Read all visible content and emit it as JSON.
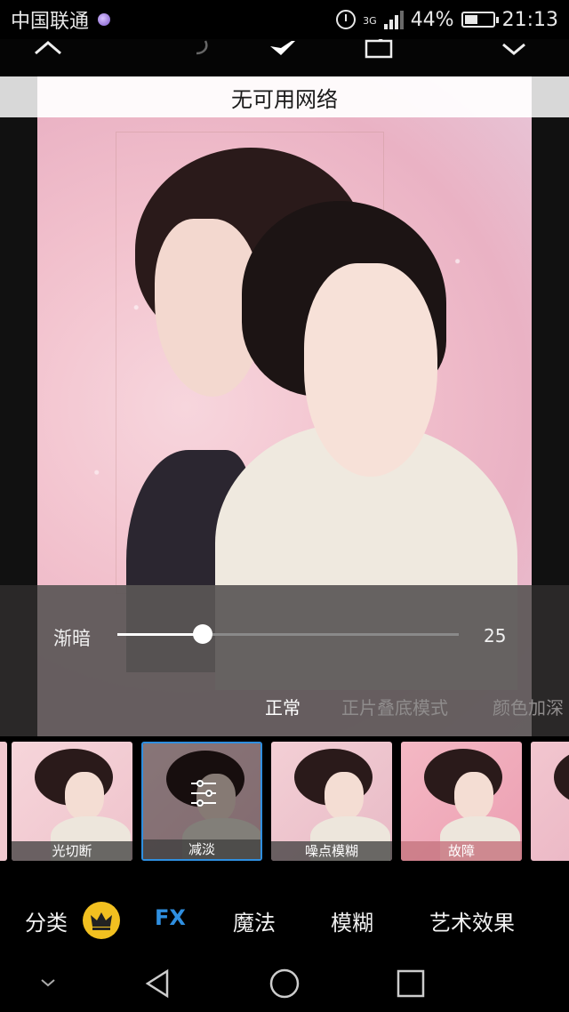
{
  "status_bar": {
    "carrier": "中国联通",
    "network": "3G",
    "battery": "44%",
    "time": "21:13"
  },
  "toolbar": {
    "icons": [
      "collapse-up-icon",
      "undo-icon",
      "eraser-icon",
      "export-icon",
      "apply-check-icon"
    ]
  },
  "canvas": {
    "network_message": "无可用网络"
  },
  "adjustment": {
    "label": "渐暗",
    "value": "25",
    "level_fraction": 0.25
  },
  "blend_modes": [
    {
      "label": "正常",
      "active": true
    },
    {
      "label": "正片叠底模式",
      "active": false
    },
    {
      "label": "颜色加深",
      "active": false
    }
  ],
  "effects": [
    {
      "label": "光切断",
      "selected": false
    },
    {
      "label": "减淡",
      "selected": true
    },
    {
      "label": "噪点模糊",
      "selected": false
    },
    {
      "label": "故障",
      "selected": false
    }
  ],
  "categories": {
    "items": [
      "分类",
      "FX",
      "魔法",
      "模糊",
      "艺术效果"
    ],
    "active": "FX",
    "accent_color": "#2f8fe0"
  },
  "system_nav": [
    "back-icon",
    "home-icon",
    "recents-icon"
  ]
}
